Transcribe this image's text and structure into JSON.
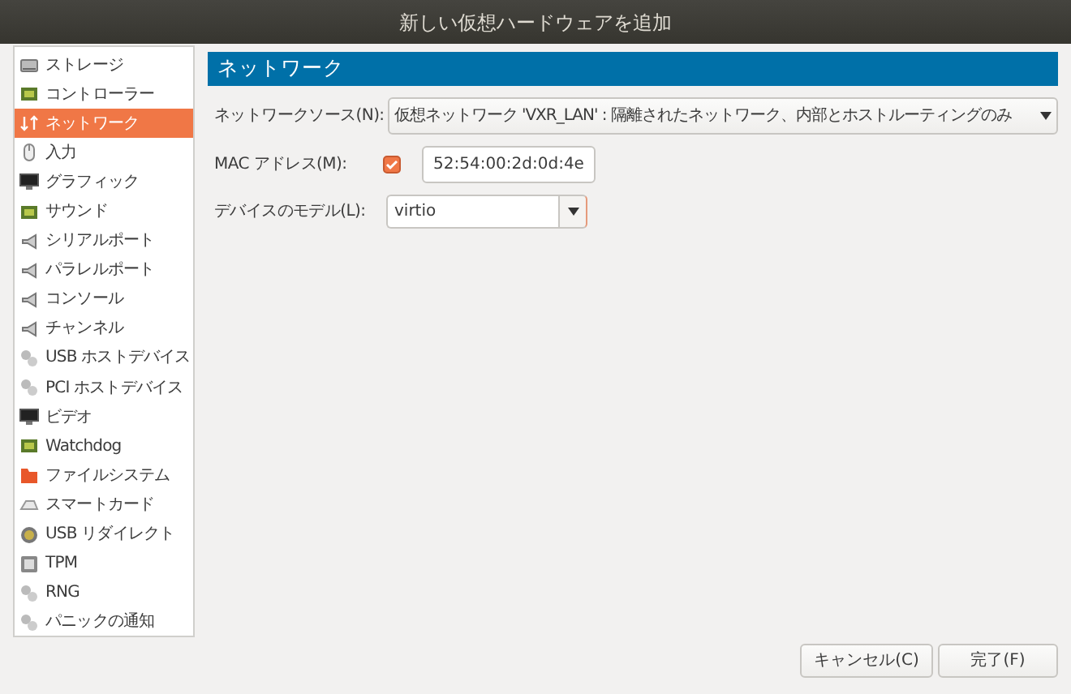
{
  "window": {
    "title": "新しい仮想ハードウェアを追加"
  },
  "sidebar": {
    "items": [
      {
        "label": "ストレージ",
        "kind": "disk",
        "selected": false
      },
      {
        "label": "コントローラー",
        "kind": "card",
        "selected": false
      },
      {
        "label": "ネットワーク",
        "kind": "network",
        "selected": true
      },
      {
        "label": "入力",
        "kind": "mouse",
        "selected": false
      },
      {
        "label": "グラフィック",
        "kind": "monitor",
        "selected": false
      },
      {
        "label": "サウンド",
        "kind": "card",
        "selected": false
      },
      {
        "label": "シリアルポート",
        "kind": "port",
        "selected": false
      },
      {
        "label": "パラレルポート",
        "kind": "port",
        "selected": false
      },
      {
        "label": "コンソール",
        "kind": "port",
        "selected": false
      },
      {
        "label": "チャンネル",
        "kind": "port",
        "selected": false
      },
      {
        "label": "USB ホストデバイス",
        "kind": "chip",
        "selected": false
      },
      {
        "label": "PCI ホストデバイス",
        "kind": "chip",
        "selected": false
      },
      {
        "label": "ビデオ",
        "kind": "monitor",
        "selected": false
      },
      {
        "label": "Watchdog",
        "kind": "card",
        "selected": false
      },
      {
        "label": "ファイルシステム",
        "kind": "folder",
        "selected": false
      },
      {
        "label": "スマートカード",
        "kind": "smartcard",
        "selected": false
      },
      {
        "label": "USB リダイレクト",
        "kind": "usb",
        "selected": false
      },
      {
        "label": "TPM",
        "kind": "tpm",
        "selected": false
      },
      {
        "label": "RNG",
        "kind": "chip",
        "selected": false
      },
      {
        "label": "パニックの通知",
        "kind": "chip",
        "selected": false
      }
    ]
  },
  "panel": {
    "title": "ネットワーク",
    "fields": [
      {
        "kind": "combo",
        "label": "ネットワークソース(N):",
        "value": "仮想ネットワーク 'VXR_LAN' : 隔離されたネットワーク、内部とホストルーティングのみ"
      },
      {
        "kind": "entry",
        "label": "MAC アドレス(M):",
        "checked": true,
        "value": "52:54:00:2d:0d:4e"
      },
      {
        "kind": "combo-entry",
        "label": "デバイスのモデル(L):",
        "value": "virtio"
      }
    ]
  },
  "buttons": [
    "キャンセル(C)",
    "完了(F)"
  ]
}
